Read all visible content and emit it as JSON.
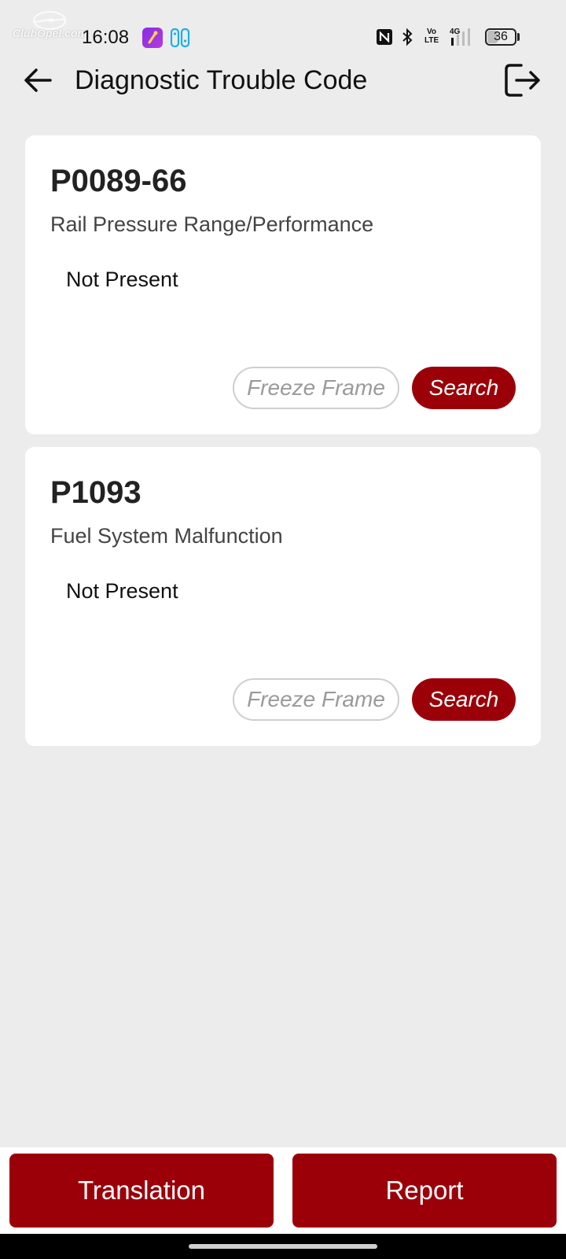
{
  "status_bar": {
    "watermark": "ClubOpel.com",
    "time": "16:08",
    "battery": "36",
    "network": "4G",
    "volte": [
      "Vo",
      "LTE"
    ],
    "icons": [
      "nfc-icon",
      "bluetooth-icon",
      "volte-icon",
      "signal-icon",
      "battery-icon"
    ]
  },
  "header": {
    "title": "Diagnostic Trouble Code",
    "back_icon": "arrow-left-icon",
    "exit_icon": "logout-icon"
  },
  "dtcs": [
    {
      "code": "P0089-66",
      "description": "Rail Pressure Range/Performance",
      "status": "Not Present",
      "freeze_frame_label": "Freeze Frame",
      "search_label": "Search"
    },
    {
      "code": "P1093",
      "description": "Fuel System Malfunction",
      "status": "Not Present",
      "freeze_frame_label": "Freeze Frame",
      "search_label": "Search"
    }
  ],
  "bottom_bar": {
    "translation_label": "Translation",
    "report_label": "Report"
  },
  "colors": {
    "accent": "#9b0009",
    "background": "#ececec",
    "card": "#ffffff"
  }
}
